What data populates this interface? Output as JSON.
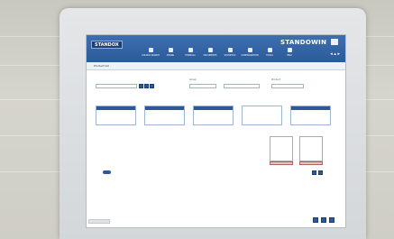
{
  "window": {
    "brand_left": "STANDOX",
    "brand_right": "STANDOWIN"
  },
  "nav": {
    "items": [
      {
        "label": "COLOUR SEARCH",
        "icon": "search-icon"
      },
      {
        "label": "MIXING",
        "icon": "flag-icon"
      },
      {
        "label": "FORMULA",
        "icon": "palette-icon"
      },
      {
        "label": "DOCUMENTS",
        "icon": "doc-icon"
      },
      {
        "label": "STATISTICS",
        "icon": "chart-icon"
      },
      {
        "label": "CONFIGURATION",
        "icon": "gear-icon"
      },
      {
        "label": "TOOLS",
        "icon": "tool-icon"
      },
      {
        "label": "HELP",
        "icon": "help-icon"
      }
    ],
    "right_icons": "◂ ▴ ▸"
  },
  "page": {
    "breadcrumb": "Product list"
  },
  "filters": {
    "left_label": "",
    "left_value": "",
    "group_label": "Group",
    "group_value": "",
    "mid_value": "",
    "product_label": "Product",
    "product_value": ""
  },
  "panels": [
    {
      "header": "",
      "row": ""
    },
    {
      "header": "",
      "row": ""
    },
    {
      "header": "",
      "row": ""
    },
    {
      "header": "",
      "row": ""
    },
    {
      "header": "",
      "row": ""
    }
  ],
  "details": {
    "line1": "",
    "line2": ""
  },
  "swatches": [
    {
      "label": ""
    },
    {
      "label": ""
    }
  ],
  "footer": {
    "button": ""
  }
}
